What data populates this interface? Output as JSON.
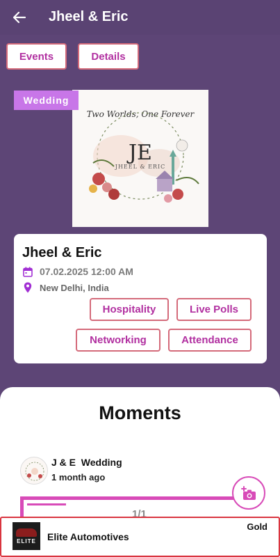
{
  "appbar": {
    "title": "Jheel & Eric",
    "back_icon": "arrow-left-icon"
  },
  "tabs": [
    {
      "label": "Events"
    },
    {
      "label": "Details"
    }
  ],
  "event": {
    "category": "Wedding",
    "cover": {
      "tagline": "Two Worlds, One Forever",
      "monogram": "JE",
      "names": "JHEEL & ERIC"
    },
    "name": "Jheel & Eric",
    "date": "07.02.2025 12:00 AM",
    "location": "New Delhi, India",
    "date_icon": "calendar-icon",
    "location_icon": "location-pin-icon",
    "actions": [
      {
        "label": "Hospitality"
      },
      {
        "label": "Live Polls"
      },
      {
        "label": "Networking"
      },
      {
        "label": "Attendance"
      }
    ]
  },
  "moments": {
    "title": "Moments",
    "post": {
      "title": "J & E  Wedding",
      "time": "1 month ago",
      "pager": "1/1"
    },
    "add_icon": "add-photo-icon"
  },
  "sponsor": {
    "name": "Elite Automotives",
    "tier": "Gold",
    "logo_text": "ELITE"
  },
  "colors": {
    "background": "#5d4576",
    "accent": "#b12fa0",
    "border": "#d46a7a",
    "badge": "#c876e8",
    "highlight": "#d84bb8",
    "sponsor_border": "#d9343f"
  }
}
